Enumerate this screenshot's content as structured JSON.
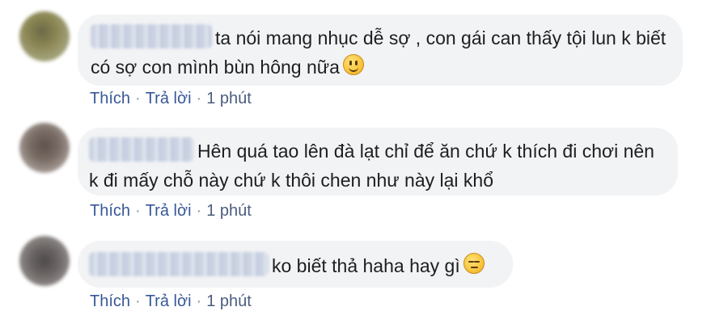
{
  "comments": [
    {
      "text": "ta nói mang nhục dễ sợ , con gái can thấy tội lun k biết có sợ con mình bùn hông nữa",
      "emoji": "smile-emoji",
      "actions": {
        "like": "Thích",
        "reply": "Trả lời",
        "time": "1 phút"
      }
    },
    {
      "text": "Hên quá tao lên đà lạt chỉ để ăn chứ k thích đi chơi nên k đi mấy chỗ này chứ k thôi chen như này lại khổ",
      "actions": {
        "like": "Thích",
        "reply": "Trả lời",
        "time": "1 phút"
      }
    },
    {
      "text": "ko biết thả haha hay gì",
      "emoji": "expressionless-emoji",
      "actions": {
        "like": "Thích",
        "reply": "Trả lời",
        "time": "1 phút"
      }
    }
  ],
  "separator": "·",
  "colors": {
    "bubble": "#f2f3f5",
    "link": "#385898",
    "text": "#1c1e21"
  }
}
